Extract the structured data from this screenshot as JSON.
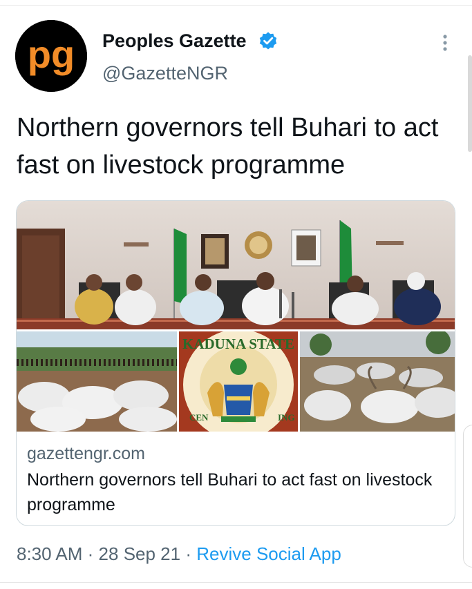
{
  "tweet": {
    "author_name": "Peoples Gazette",
    "author_handle": "@GazetteNGR",
    "avatar_text": "pg",
    "text": "Northern governors tell Buhari to act fast on livestock programme",
    "time": "8:30 AM",
    "date": "28 Sep 21",
    "separator": "·",
    "source": "Revive Social App"
  },
  "card": {
    "domain": "gazettengr.com",
    "title": "Northern governors tell Buhari to act fast on livestock programme",
    "seal_text": "KADUNA STATE",
    "seal_partial_left": "CEN",
    "seal_partial_right": "ING"
  },
  "colors": {
    "accent": "#1d9bf0",
    "avatar_orange": "#f28c28",
    "secondary_text": "#536471"
  },
  "icons": {
    "verified": "verified-badge-icon",
    "more": "more-vertical-icon"
  }
}
